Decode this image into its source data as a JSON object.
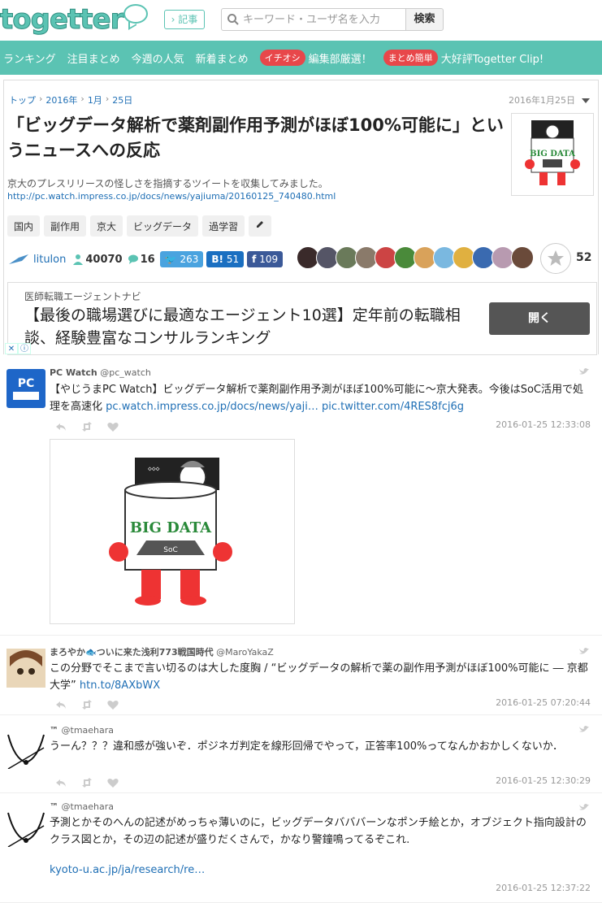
{
  "header": {
    "logo": "togetter",
    "kiji_label": "記事",
    "search_placeholder": "キーワード・ユーザ名を入力",
    "search_button": "検索"
  },
  "nav": {
    "items": [
      "ランキング",
      "注目まとめ",
      "今週の人気",
      "新着まとめ"
    ],
    "badge1": "イチオシ",
    "badge1_text": "編集部厳選！",
    "badge2": "まとめ簡単",
    "badge2_text": "大好評Togetter Clip!"
  },
  "breadcrumb": [
    "トップ",
    "2016年",
    "1月",
    "25日"
  ],
  "date": "2016年1月25日",
  "title": "「ビッグデータ解析で薬剤副作用予測がほぼ100%可能に」というニュースへの反応",
  "thumb_label": "BIG DATA",
  "description": "京大のプレスリリースの怪しさを指摘するツイートを収集してみました。",
  "description_link": "http://pc.watch.impress.co.jp/docs/news/yajiuma/20160125_740480.html",
  "tags": [
    "国内",
    "副作用",
    "京大",
    "ビッグデータ",
    "過学習"
  ],
  "stats": {
    "user": "litulon",
    "views": "40070",
    "comments": "16",
    "tweets": "263",
    "hatena": "51",
    "facebook": "109",
    "favorites": "52"
  },
  "ad": {
    "sponsor": "医師転職エージェントナビ",
    "text": "【最後の職場選びに最適なエージェント10選】定年前の転職相談、経験豊富なコンサルランキング",
    "button": "開く"
  },
  "tweets": [
    {
      "name": "PC Watch",
      "handle": "@pc_watch",
      "text": "【やじうまPC Watch】ビッグデータ解析で薬剤副作用予測がほぼ100%可能に～京大発表。今後はSoC活用で処理を高速化",
      "link1": "pc.watch.impress.co.jp/docs/news/yaji…",
      "link2": "pic.twitter.com/4RES8fcj6g",
      "time": "2016-01-25 12:33:08",
      "media_label": "BIG DATA",
      "chip_label": "SoC"
    },
    {
      "name": "まろやか🐟ついに来た浅利773戦国時代",
      "handle": "@MaroYakaZ",
      "text": "この分野でそこまで言い切るのは大した度胸 / “ビッグデータの解析で薬の副作用予測がほぼ100%可能に ― 京都大学”",
      "link1": "htn.to/8AXbWX",
      "time": "2016-01-25 07:20:44"
    },
    {
      "name": "™",
      "handle": "@tmaehara",
      "text": "うーん？？？違和感が強いぞ．ポジネガ判定を線形回帰でやって，正答率100%ってなんかおかしくないか．",
      "time": "2016-01-25 12:30:29"
    },
    {
      "name": "™",
      "handle": "@tmaehara",
      "text": "予測とかそのへんの記述がめっちゃ薄いのに，ビッグデータバババーンなポンチ絵とか，オブジェクト指向設計のクラス図とか，その辺の記述が盛りだくさんで，かなり警鐘鳴ってるぞこれ.",
      "link1": "kyoto-u.ac.jp/ja/research/re…",
      "time": "2016-01-25 12:37:22"
    }
  ]
}
